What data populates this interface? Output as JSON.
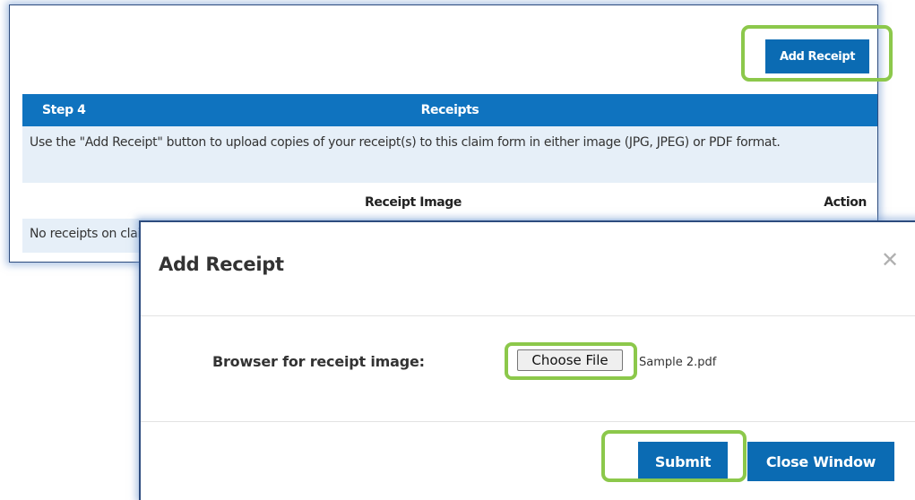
{
  "receipts_panel": {
    "add_receipt_label": "Add Receipt",
    "step_label": "Step 4",
    "section_title": "Receipts",
    "instructions": "Use the \"Add Receipt\" button to upload copies of your receipt(s) to this claim form in either image (JPG, JPEG) or PDF format.",
    "columns": [
      "Receipt Image",
      "Action"
    ],
    "empty_message": "No receipts on claim."
  },
  "modal": {
    "title": "Add Receipt",
    "close_icon": "close-icon",
    "browse_label": "Browser for receipt image:",
    "choose_file_label": "Choose File",
    "file_name": "Sample 2.pdf",
    "submit_label": "Submit",
    "close_window_label": "Close Window"
  },
  "colors": {
    "primary_blue": "#0b6bb3",
    "header_blue": "#0f73bf",
    "row_light_blue": "#e6eff8",
    "highlight_green": "#8cc84b"
  }
}
